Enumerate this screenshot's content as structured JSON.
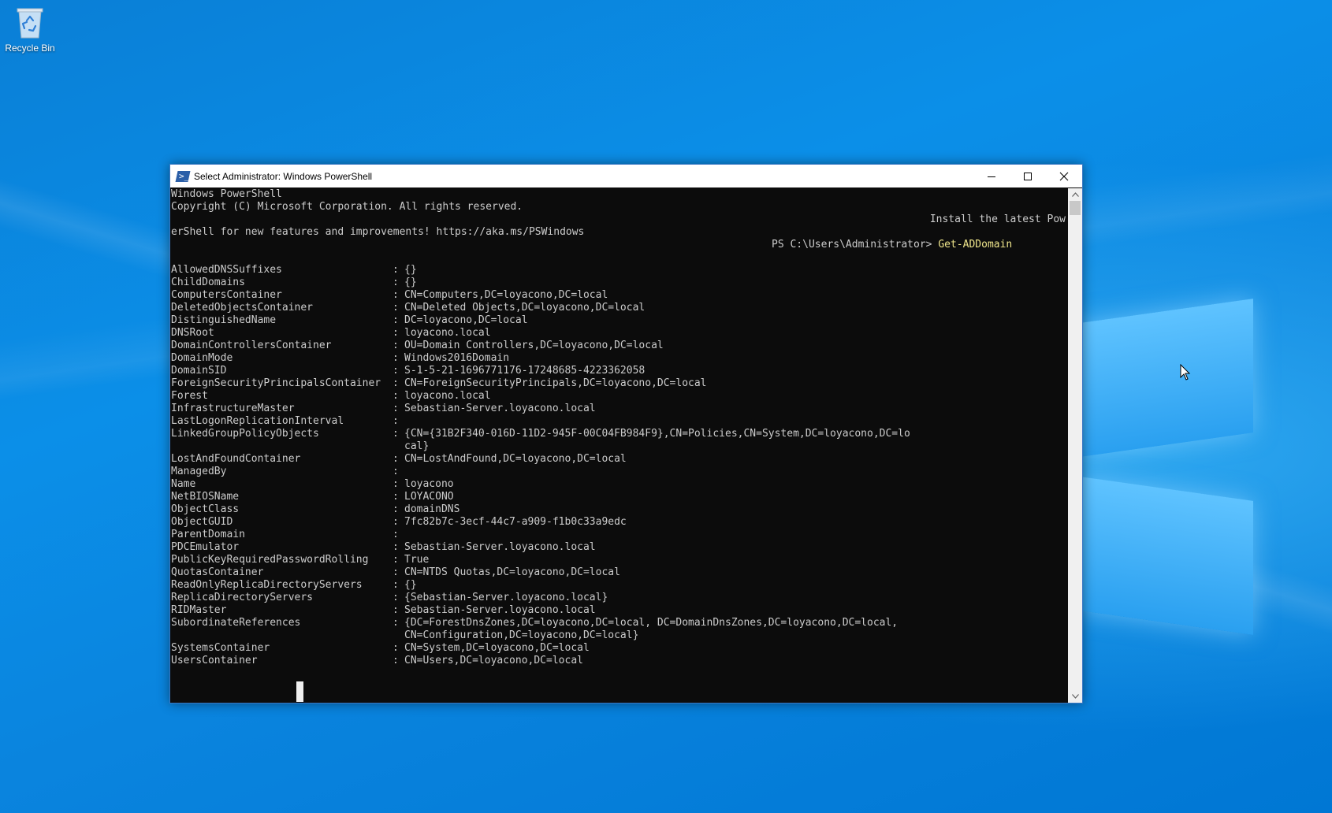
{
  "desktop": {
    "recycle_bin_label": "Recycle Bin"
  },
  "window": {
    "title": "Select Administrator: Windows PowerShell",
    "minimize_glyph": "—",
    "maximize_glyph": "☐",
    "close_glyph": "✕"
  },
  "console": {
    "header_line1": "Windows PowerShell",
    "header_line2": "Copyright (C) Microsoft Corporation. All rights reserved.",
    "header_line3": "Install the latest Pow",
    "header_line4": "erShell for new features and improvements! https://aka.ms/PSWindows",
    "prompt": "PS C:\\Users\\Administrator> ",
    "command": "Get-ADDomain",
    "properties": [
      {
        "name": "AllowedDNSSuffixes",
        "value": "{}"
      },
      {
        "name": "ChildDomains",
        "value": "{}"
      },
      {
        "name": "ComputersContainer",
        "value": "CN=Computers,DC=loyacono,DC=local"
      },
      {
        "name": "DeletedObjectsContainer",
        "value": "CN=Deleted Objects,DC=loyacono,DC=local"
      },
      {
        "name": "DistinguishedName",
        "value": "DC=loyacono,DC=local"
      },
      {
        "name": "DNSRoot",
        "value": "loyacono.local"
      },
      {
        "name": "DomainControllersContainer",
        "value": "OU=Domain Controllers,DC=loyacono,DC=local"
      },
      {
        "name": "DomainMode",
        "value": "Windows2016Domain"
      },
      {
        "name": "DomainSID",
        "value": "S-1-5-21-1696771176-17248685-4223362058"
      },
      {
        "name": "ForeignSecurityPrincipalsContainer",
        "value": "CN=ForeignSecurityPrincipals,DC=loyacono,DC=local"
      },
      {
        "name": "Forest",
        "value": "loyacono.local"
      },
      {
        "name": "InfrastructureMaster",
        "value": "Sebastian-Server.loyacono.local"
      },
      {
        "name": "LastLogonReplicationInterval",
        "value": ""
      },
      {
        "name": "LinkedGroupPolicyObjects",
        "value": "{CN={31B2F340-016D-11D2-945F-00C04FB984F9},CN=Policies,CN=System,DC=loyacono,DC=lo"
      },
      {
        "name": "",
        "value": "cal}",
        "continuation": true
      },
      {
        "name": "LostAndFoundContainer",
        "value": "CN=LostAndFound,DC=loyacono,DC=local"
      },
      {
        "name": "ManagedBy",
        "value": ""
      },
      {
        "name": "Name",
        "value": "loyacono"
      },
      {
        "name": "NetBIOSName",
        "value": "LOYACONO"
      },
      {
        "name": "ObjectClass",
        "value": "domainDNS"
      },
      {
        "name": "ObjectGUID",
        "value": "7fc82b7c-3ecf-44c7-a909-f1b0c33a9edc"
      },
      {
        "name": "ParentDomain",
        "value": ""
      },
      {
        "name": "PDCEmulator",
        "value": "Sebastian-Server.loyacono.local"
      },
      {
        "name": "PublicKeyRequiredPasswordRolling",
        "value": "True"
      },
      {
        "name": "QuotasContainer",
        "value": "CN=NTDS Quotas,DC=loyacono,DC=local"
      },
      {
        "name": "ReadOnlyReplicaDirectoryServers",
        "value": "{}"
      },
      {
        "name": "ReplicaDirectoryServers",
        "value": "{Sebastian-Server.loyacono.local}"
      },
      {
        "name": "RIDMaster",
        "value": "Sebastian-Server.loyacono.local"
      },
      {
        "name": "SubordinateReferences",
        "value": "{DC=ForestDnsZones,DC=loyacono,DC=local, DC=DomainDnsZones,DC=loyacono,DC=local,"
      },
      {
        "name": "",
        "value": "CN=Configuration,DC=loyacono,DC=local}",
        "continuation": true
      },
      {
        "name": "SystemsContainer",
        "value": "CN=System,DC=loyacono,DC=local"
      },
      {
        "name": "UsersContainer",
        "value": "CN=Users,DC=loyacono,DC=local"
      }
    ]
  },
  "colors": {
    "console_bg": "#0c0c0c",
    "console_text": "#cccccc",
    "command_text": "#f0e68c",
    "desktop_blue": "#0a84de"
  }
}
